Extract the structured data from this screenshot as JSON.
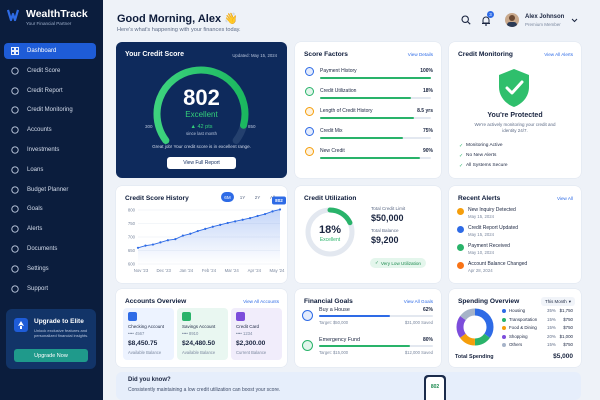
{
  "brand": {
    "name": "WealthTrack",
    "tagline": "Your Financial Partner"
  },
  "nav": [
    {
      "label": "Dashboard",
      "icon": "grid-icon"
    },
    {
      "label": "Credit Score",
      "icon": "gauge-icon"
    },
    {
      "label": "Credit Report",
      "icon": "document-icon"
    },
    {
      "label": "Credit Monitoring",
      "icon": "shield-icon"
    },
    {
      "label": "Accounts",
      "icon": "bank-icon"
    },
    {
      "label": "Investments",
      "icon": "chart-icon"
    },
    {
      "label": "Loans",
      "icon": "wallet-icon"
    },
    {
      "label": "Budget Planner",
      "icon": "calculator-icon"
    },
    {
      "label": "Goals",
      "icon": "target-icon"
    },
    {
      "label": "Alerts",
      "icon": "bell-icon"
    },
    {
      "label": "Documents",
      "icon": "folder-icon"
    },
    {
      "label": "Settings",
      "icon": "gear-icon"
    },
    {
      "label": "Support",
      "icon": "help-icon"
    }
  ],
  "upgrade": {
    "title": "Upgrade to Elite",
    "text": "Unlock exclusive features and personalized financial insights.",
    "button": "Upgrade Now"
  },
  "header": {
    "greeting": "Good Morning, Alex 👋",
    "subtitle": "Here's what's happening with your finances today.",
    "notif_count": "3",
    "user_name": "Alex Johnson",
    "user_plan": "Premium Member"
  },
  "credit_score": {
    "title": "Your Credit Score",
    "updated": "Updated: May 15, 2024",
    "score": "802",
    "rating": "Excellent",
    "change": "▲ 42 pts",
    "change_note": "since last month",
    "min": "300",
    "max": "850",
    "message": "Great job! Your credit score is in excellent range.",
    "button": "View Full Report",
    "score_value": 802,
    "score_min": 300,
    "score_max": 850
  },
  "score_factors": {
    "title": "Score Factors",
    "link": "View Details",
    "items": [
      {
        "label": "Payment History",
        "value": "100%",
        "pct": 100,
        "color": "#2e6be6"
      },
      {
        "label": "Credit Utilization",
        "value": "18%",
        "pct": 82,
        "color": "#29b36a"
      },
      {
        "label": "Length of Credit History",
        "value": "8.5 yrs",
        "pct": 85,
        "color": "#f59e0b"
      },
      {
        "label": "Credit Mix",
        "value": "75%",
        "pct": 75,
        "color": "#2e6be6"
      },
      {
        "label": "New Credit",
        "value": "90%",
        "pct": 90,
        "color": "#f59e0b"
      }
    ]
  },
  "monitoring": {
    "title": "Credit Monitoring",
    "link": "View All Alerts",
    "status": "You're Protected",
    "desc": "We're actively monitoring your credit and identity 24/7.",
    "items": [
      "Monitoring Active",
      "No New Alerts",
      "All Systems Secure"
    ]
  },
  "history": {
    "title": "Credit Score History",
    "ranges": [
      "6M",
      "1Y",
      "2Y",
      "All"
    ],
    "active_range": "6M",
    "badge": "802"
  },
  "chart_data": {
    "type": "area",
    "title": "Credit Score History",
    "x": [
      "Nov '23",
      "Dec '23",
      "Jan '24",
      "Feb '24",
      "Mar '24",
      "Apr '24",
      "May '24"
    ],
    "y_ticks": [
      "800",
      "750",
      "700",
      "650",
      "600"
    ],
    "ylim": [
      600,
      800
    ],
    "series": [
      {
        "values": [
          660,
          668,
          672,
          680,
          688,
          692,
          705,
          712,
          722,
          730,
          738,
          745,
          752,
          758,
          764,
          770,
          778,
          785,
          795,
          802
        ]
      }
    ],
    "grid": true
  },
  "utilization": {
    "title": "Credit Utilization",
    "pct": "18%",
    "pct_value": 18,
    "rating": "Excellent",
    "limit_label": "Total Credit Limit",
    "limit": "$50,000",
    "balance_label": "Total Balance",
    "balance": "$9,200",
    "chip": "Very Low Utilization"
  },
  "alerts": {
    "title": "Recent Alerts",
    "link": "View All",
    "items": [
      {
        "title": "New Inquiry Detected",
        "date": "May 15, 2024",
        "color": "#f59e0b"
      },
      {
        "title": "Credit Report Updated",
        "date": "May 15, 2024",
        "color": "#2e6be6"
      },
      {
        "title": "Payment Received",
        "date": "May 10, 2024",
        "color": "#29b36a"
      },
      {
        "title": "Account Balance Changed",
        "date": "Apr 28, 2024",
        "color": "#f97316"
      }
    ]
  },
  "accounts": {
    "title": "Accounts Overview",
    "link": "View All Accounts",
    "items": [
      {
        "name": "Checking Account",
        "num": "•••• 4567",
        "amount": "$8,450.75",
        "sub": "Available Balance",
        "bg": "#edf3ff",
        "accent": "#2e6be6"
      },
      {
        "name": "Savings Account",
        "num": "•••• 8910",
        "amount": "$24,480.50",
        "sub": "Available Balance",
        "bg": "#e9f7f1",
        "accent": "#29b36a"
      },
      {
        "name": "Credit Card",
        "num": "•••• 1234",
        "amount": "$2,300.00",
        "sub": "Current Balance",
        "bg": "#f1edfb",
        "accent": "#7c4ddb"
      }
    ]
  },
  "goals": {
    "title": "Financial Goals",
    "link": "View All Goals",
    "items": [
      {
        "name": "Buy a House",
        "pct": "62%",
        "pct_value": 62,
        "target": "Target: $50,000",
        "saved": "$31,000 Saved",
        "color": "#2e6be6"
      },
      {
        "name": "Emergency Fund",
        "pct": "80%",
        "pct_value": 80,
        "target": "Target: $15,000",
        "saved": "$12,000 Saved",
        "color": "#29b36a"
      }
    ]
  },
  "spending": {
    "title": "Spending Overview",
    "period": "This Month",
    "items": [
      {
        "label": "Housing",
        "pct": "35%",
        "value": 35,
        "amount": "$1,750",
        "color": "#2e6be6"
      },
      {
        "label": "Transportation",
        "pct": "15%",
        "value": 15,
        "amount": "$750",
        "color": "#29b36a"
      },
      {
        "label": "Food & Dining",
        "pct": "15%",
        "value": 15,
        "amount": "$750",
        "color": "#f59e0b"
      },
      {
        "label": "Shopping",
        "pct": "20%",
        "value": 20,
        "amount": "$1,000",
        "color": "#7c4ddb"
      },
      {
        "label": "Others",
        "pct": "15%",
        "value": 15,
        "amount": "$750",
        "color": "#a6b3c8"
      }
    ],
    "total_label": "Total Spending",
    "total": "$5,000"
  },
  "tip": {
    "title": "Did you know?",
    "text": "Consistently maintaining a low credit utilization can boost your score.",
    "phone_score": "802"
  }
}
